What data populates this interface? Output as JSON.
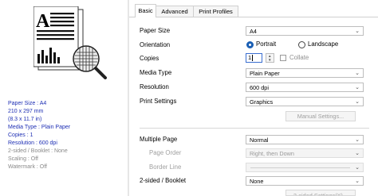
{
  "left_panel": {
    "info": [
      {
        "text": "Paper Size : A4",
        "style": "blue"
      },
      {
        "text": "210 x 297 mm",
        "style": "blue"
      },
      {
        "text": "(8.3 x 11.7 in)",
        "style": "blue"
      },
      {
        "text": "Media Type : Plain Paper",
        "style": "blue"
      },
      {
        "text": "Copies : 1",
        "style": "blue"
      },
      {
        "text": "Resolution : 600 dpi",
        "style": "blue"
      },
      {
        "text": "2-sided / Booklet : None",
        "style": "grey"
      },
      {
        "text": "Scaling : Off",
        "style": "grey"
      },
      {
        "text": "Watermark : Off",
        "style": "grey"
      }
    ]
  },
  "tabs": [
    {
      "label": "Basic",
      "active": true
    },
    {
      "label": "Advanced",
      "active": false
    },
    {
      "label": "Print Profiles",
      "active": false
    }
  ],
  "settings": {
    "paper_size": {
      "label": "Paper Size",
      "value": "A4"
    },
    "orientation": {
      "label": "Orientation",
      "options": [
        "Portrait",
        "Landscape"
      ],
      "selected": "Portrait"
    },
    "copies": {
      "label": "Copies",
      "value": "1",
      "collate_label": "Collate",
      "collate_checked": false
    },
    "media_type": {
      "label": "Media Type",
      "value": "Plain Paper"
    },
    "resolution": {
      "label": "Resolution",
      "value": "600 dpi"
    },
    "print_settings": {
      "label": "Print Settings",
      "value": "Graphics",
      "manual_button": "Manual Settings..."
    },
    "multiple_page": {
      "label": "Multiple Page",
      "value": "Normal"
    },
    "page_order": {
      "label": "Page Order",
      "value": "Right, then Down"
    },
    "border_line": {
      "label": "Border Line",
      "value": ""
    },
    "two_sided": {
      "label": "2-sided / Booklet",
      "value": "None",
      "button": "2-sided Settings(X)..."
    }
  },
  "colors": {
    "accent": "#1a5fb4",
    "info_blue": "#1e2fb4",
    "disabled": "#a0a0a0"
  },
  "icons": {
    "dropdown": "chevron-down-icon",
    "preview": "document-preview-magnifier-icon"
  }
}
